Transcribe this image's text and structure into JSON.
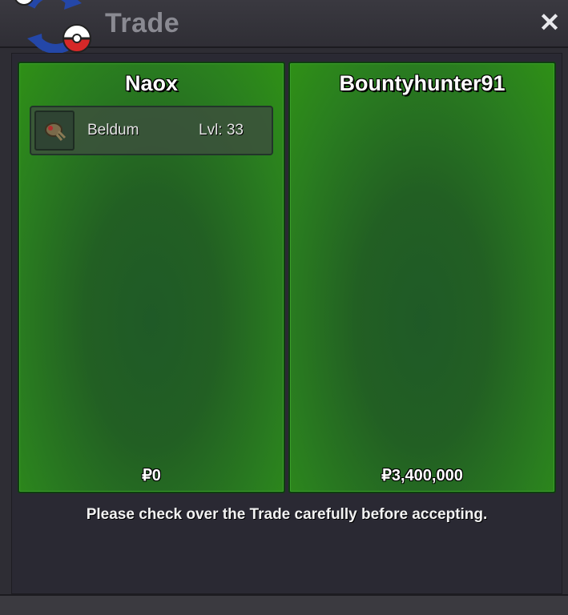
{
  "window": {
    "title": "Trade",
    "close_icon": "close-icon",
    "logo_icon": "trade-swap-pokeball-icon"
  },
  "trade": {
    "left": {
      "player_name": "Naox",
      "items": [
        {
          "icon": "beldum-sprite-icon",
          "name": "Beldum",
          "level": "Lvl: 33"
        }
      ],
      "money": "₽0"
    },
    "right": {
      "player_name": "Bountyhunter91",
      "items": [],
      "money": "₽3,400,000"
    },
    "notice": "Please check over the Trade carefully before accepting."
  },
  "colors": {
    "panel_green": "#2f9016",
    "panel_dark_green": "#1f5a27",
    "background": "#2e2d34"
  }
}
